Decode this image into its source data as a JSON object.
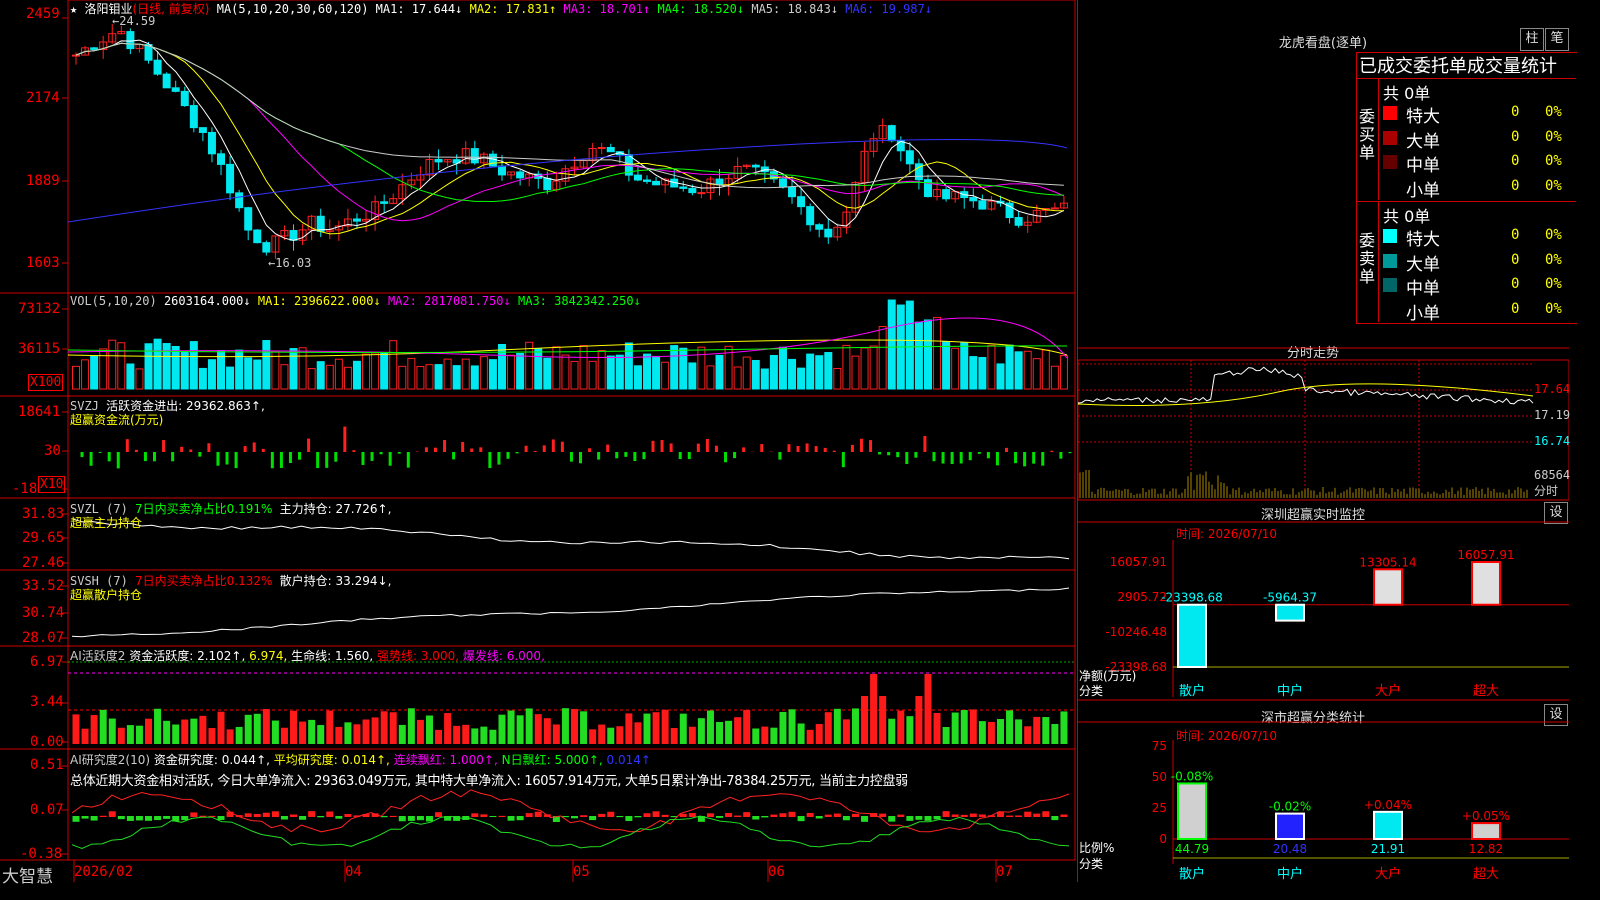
{
  "app": {
    "logo": "大智慧",
    "star": "★"
  },
  "main": {
    "header": {
      "stock": "洛阳钼业",
      "mode": "(日线, 前复权)",
      "ma_label": "MA(5,10,20,30,60,120)",
      "ma_values": [
        {
          "label": "MA1: 17.644",
          "arrow": "↓",
          "color": "#ffffff"
        },
        {
          "label": "MA2: 17.831",
          "arrow": "↑",
          "color": "#ffff00"
        },
        {
          "label": "MA3: 18.701",
          "arrow": "↑",
          "color": "#ff00ff"
        },
        {
          "label": "MA4: 18.520",
          "arrow": "↓",
          "color": "#00ff00"
        },
        {
          "label": "MA5: 18.843",
          "arrow": "↓",
          "color": "#cccccc"
        },
        {
          "label": "MA6: 19.987",
          "arrow": "↓",
          "color": "#3333ff"
        }
      ],
      "high_label": "←24.59",
      "low_label": "←16.03"
    },
    "y_ticks": [
      "2459",
      "2174",
      "1889",
      "1603"
    ],
    "vol": {
      "title": "VOL(5,10,20)",
      "value": "2603164.000↓",
      "ma1": "MA1: 2396622.000↓",
      "ma2": "MA2: 2817081.750↓",
      "ma3": "MA3: 3842342.250↓",
      "y_ticks": [
        "73132",
        "36115"
      ],
      "unit": "X100"
    },
    "svzj": {
      "title": "SVZJ",
      "value": "活跃资金进出: 29362.863↑,",
      "sub": "超赢资金流(万元)",
      "y_ticks": [
        "18641",
        "30",
        "-18"
      ],
      "unit": "X10"
    },
    "svzl": {
      "title": "SVZL (7)",
      "ratio": "7日内买卖净占比0.191%",
      "hold": "主力持仓: 27.726↑,",
      "sub": "超赢主力持仓",
      "y_ticks": [
        "31.83",
        "29.65",
        "27.46"
      ]
    },
    "svsh": {
      "title": "SVSH (7)",
      "ratio": "7日内买卖净占比0.132%",
      "hold": "散户持仓: 33.294↓,",
      "sub": "超赢散户持仓",
      "y_ticks": [
        "33.52",
        "30.74",
        "28.07"
      ]
    },
    "ai_active": {
      "title": "AI活跃度2",
      "v1": "资金活跃度: 2.102↑,",
      "v2": "6.974,",
      "v3": "生命线: 1.560,",
      "v4": "强势线: 3.000,",
      "v5": "爆发线: 6.000,",
      "y_ticks": [
        "6.97",
        "3.44",
        "0.00"
      ]
    },
    "ai_research": {
      "title": "AI研究度2(10)",
      "v1": "资金研究度: 0.044↑,",
      "v2": "平均研究度: 0.014↑,",
      "v3": "连续飘红: 1.000↑,",
      "v4": "N日飘红: 5.000↑,",
      "v5": "0.014↑",
      "summary": "总体近期大资金相对活跃, 今日大单净流入: 29363.049万元, 其中特大单净流入: 16057.914万元, 大单5日累计净出-78384.25万元, 当前主力控盘弱",
      "y_ticks": [
        "0.51",
        "0.07",
        "-0.38"
      ]
    },
    "x_axis": [
      "2026/02",
      "04",
      "05",
      "06",
      "07"
    ]
  },
  "right": {
    "lhb": {
      "title": "龙虎看盘(逐单)",
      "btn1": "柱",
      "btn2": "笔",
      "header": "已成交委托单成交量统计",
      "buy_label": "委买单",
      "sell_label": "委卖单",
      "buy_total": "共 0单",
      "sell_total": "共 0单",
      "buy_rows": [
        {
          "name": "特大",
          "count": "0",
          "pct": "0%",
          "color": "#ff0000"
        },
        {
          "name": "大单",
          "count": "0",
          "pct": "0%",
          "color": "#aa0000"
        },
        {
          "name": "中单",
          "count": "0",
          "pct": "0%",
          "color": "#660000"
        },
        {
          "name": "小单",
          "count": "0",
          "pct": "0%",
          "color": "#000000"
        }
      ],
      "sell_rows": [
        {
          "name": "特大",
          "count": "0",
          "pct": "0%",
          "color": "#00ffff"
        },
        {
          "name": "大单",
          "count": "0",
          "pct": "0%",
          "color": "#009999"
        },
        {
          "name": "中单",
          "count": "0",
          "pct": "0%",
          "color": "#006666"
        },
        {
          "name": "小单",
          "count": "0",
          "pct": "0%",
          "color": "#000000"
        }
      ]
    },
    "intraday": {
      "title": "分时走势",
      "ticks": [
        "17.64",
        "17.19",
        "16.74",
        "68564"
      ],
      "unit": "分时"
    },
    "sz_monitor": {
      "title": "深圳超赢实时监控",
      "btn": "设",
      "time": "时间: 2026/07/10",
      "y_ticks": [
        "16057.91",
        "2905.72",
        "-10246.48",
        "-23398.68"
      ],
      "y_label": "净额(万元)",
      "x_label": "分类",
      "categories": [
        "散户",
        "中户",
        "大户",
        "超大"
      ],
      "values": [
        "-23398.68",
        "-5964.37",
        "13305.14",
        "16057.91"
      ]
    },
    "sz_class": {
      "title": "深市超赢分类统计",
      "btn": "设",
      "time": "时间: 2026/07/10",
      "y_ticks": [
        "75",
        "50",
        "25",
        "0"
      ],
      "y_label": "比例%",
      "x_label": "分类",
      "categories": [
        "散户",
        "中户",
        "大户",
        "超大"
      ],
      "changes": [
        "-0.08%",
        "-0.02%",
        "+0.04%",
        "+0.05%"
      ],
      "values": [
        "44.79",
        "20.48",
        "21.91",
        "12.82"
      ]
    }
  },
  "chart_data": [
    {
      "type": "bar",
      "title": "深圳超赢实时监控",
      "categories": [
        "散户",
        "中户",
        "大户",
        "超大"
      ],
      "values": [
        -23398.68,
        -5964.37,
        13305.14,
        16057.91
      ],
      "ylabel": "净额(万元)",
      "xlabel": "分类",
      "ylim": [
        -23398.68,
        16057.91
      ]
    },
    {
      "type": "bar",
      "title": "深市超赢分类统计",
      "categories": [
        "散户",
        "中户",
        "大户",
        "超大"
      ],
      "values": [
        44.79,
        20.48,
        21.91,
        12.82
      ],
      "ylabel": "比例%",
      "xlabel": "分类",
      "ylim": [
        0,
        75
      ]
    }
  ]
}
